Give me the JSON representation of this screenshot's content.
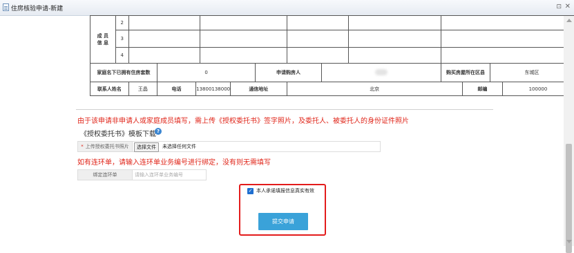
{
  "window": {
    "title": "住房核验申请-新建",
    "restore_glyph": "⊡",
    "close_glyph": "✕"
  },
  "members": {
    "label": "成  员\n信  息",
    "rows": [
      "2",
      "3",
      "4"
    ]
  },
  "house_row": {
    "owned_label": "家庭名下已拥有住房套数",
    "owned_value": "0",
    "applicant_label": "申请购房人",
    "district_label": "购买房屋所在区县",
    "district_value": "东城区"
  },
  "contact_row": {
    "name_label": "联系人姓名",
    "name_value": "王晶",
    "phone_label": "电话",
    "phone_value": "13800138000",
    "address_label": "通信地址",
    "address_value": "北京",
    "postcode_label": "邮编",
    "postcode_value": "100000"
  },
  "notice1": "由于该申请非申请人或家庭成员填写，需上传《授权委托书》签字照片，及委托人、被委托人的身份证件照片",
  "template_download": "《授权委托书》模板下载",
  "help_glyph": "?",
  "upload": {
    "required_mark": "*",
    "label": "上传授权委托书照片",
    "button": "选择文件",
    "status": "未选择任何文件"
  },
  "notice2": "如有连环单，请输入连环单业务编号进行绑定，没有则无需填写",
  "chain": {
    "label": "绑定连环单",
    "placeholder": "请输入连环单业务编号"
  },
  "agreement": {
    "checked": true,
    "check_glyph": "✓",
    "label": "本人承诺填报信息真实有效"
  },
  "submit_label": "提交申请",
  "colors": {
    "notice_red": "#e0261a",
    "highlight_red": "#e31b1b",
    "submit_blue": "#3aa2d9",
    "checkbox_blue": "#1f6fd0"
  }
}
